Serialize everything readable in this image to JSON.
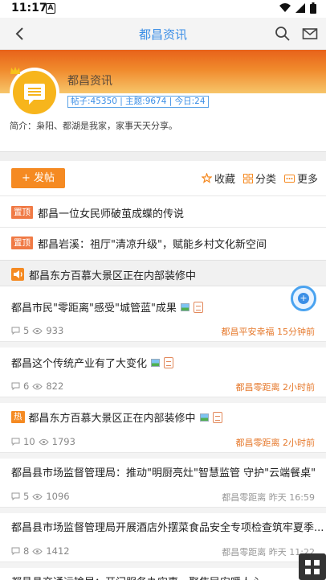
{
  "status_bar": {
    "time": "11:17",
    "notif_letter": "A"
  },
  "nav": {
    "title": "都昌资讯"
  },
  "forum": {
    "name": "都昌资讯",
    "stats": "帖子:45350 | 主题:9674 | 今日:24",
    "intro": "简介：枭阳、都湖是我家，家事天天分享。"
  },
  "actions": {
    "post_label": "+ 发帖",
    "collect_label": "收藏",
    "category_label": "分类",
    "more_label": "更多"
  },
  "pinned": [
    {
      "tag": "置顶",
      "title": "都昌一位女民师破茧成蝶的传说"
    },
    {
      "tag": "置顶",
      "title": "都昌岩溪：祖厅\"清凉升级\"，赋能乡村文化新空间"
    }
  ],
  "notice": {
    "text": "都昌东方百慕大景区正在内部装修中"
  },
  "posts": [
    {
      "title": "都昌市民\"零距离\"感受\"城管蓝\"成果",
      "replies": "5",
      "views": "933",
      "author_time": "都昌平安幸福 15分钟前",
      "highlight": true
    },
    {
      "title": "都昌这个传统产业有了大变化",
      "replies": "6",
      "views": "822",
      "author_time": "都昌零距离 2小时前",
      "highlight": true
    },
    {
      "tag": "热",
      "title": "都昌东方百慕大景区正在内部装修中",
      "replies": "10",
      "views": "1793",
      "author_time": "都昌零距离 2小时前",
      "highlight": true
    },
    {
      "title": "都昌县市场监督管理局：推动\"明厨亮灶\"智慧监管 守护\"云端餐桌\"",
      "replies": "5",
      "views": "1096",
      "author_time": "都昌零距离 昨天 16:59",
      "highlight": false
    },
    {
      "title": "都昌县市场监督管理局开展酒店外摆菜食品安全专项检查筑牢夏季...",
      "replies": "8",
      "views": "1412",
      "author_time": "都昌零距离 昨天 11:22",
      "highlight": false
    },
    {
      "title": "都昌县交通运输局：开门服务办实事，聚焦民安暖人心",
      "replies": "",
      "views": "",
      "author_time": "",
      "highlight": false
    }
  ]
}
